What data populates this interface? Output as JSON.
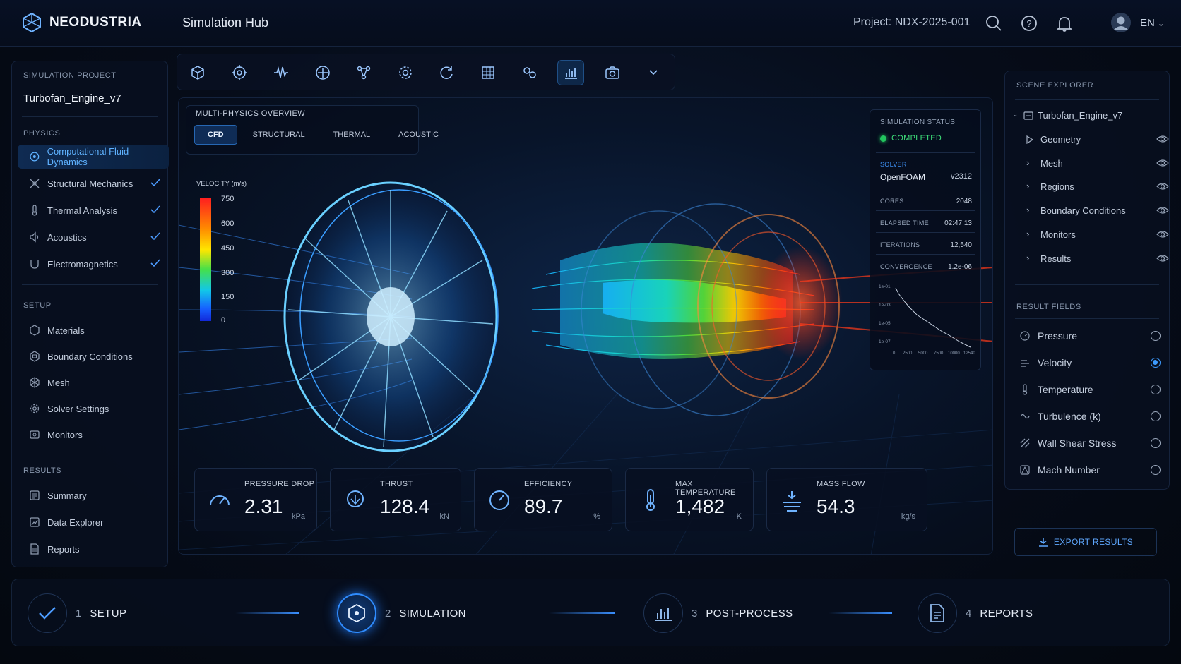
{
  "header": {
    "brand": "NEODUSTRIA",
    "hub": "Simulation Hub",
    "project": "Project: NDX-2025-001",
    "lang": "EN"
  },
  "sidebar": {
    "project_label": "SIMULATION PROJECT",
    "project_name": "Turbofan_Engine_v7",
    "physics_label": "PHYSICS",
    "physics": [
      "Computational Fluid Dynamics",
      "Structural Mechanics",
      "Thermal Analysis",
      "Acoustics",
      "Electromagnetics"
    ],
    "setup_label": "SETUP",
    "setup": [
      "Materials",
      "Boundary Conditions",
      "Mesh",
      "Solver Settings",
      "Monitors"
    ],
    "results_label": "RESULTS",
    "results": [
      "Summary",
      "Data Explorer",
      "Reports"
    ]
  },
  "viewport": {
    "title": "MULTI-PHYSICS OVERVIEW",
    "tabs": [
      "CFD",
      "STRUCTURAL",
      "THERMAL",
      "ACOUSTIC"
    ],
    "legend": {
      "title": "VELOCITY (m/s)",
      "ticks": [
        "750",
        "600",
        "450",
        "300",
        "150",
        "0"
      ]
    },
    "status": {
      "title": "SIMULATION STATUS",
      "state": "COMPLETED",
      "solver_label": "SOLVER",
      "solver": "OpenFOAM",
      "version": "v2312",
      "rows": [
        {
          "k": "CORES",
          "v": "2048"
        },
        {
          "k": "ELAPSED TIME",
          "v": "02:47:13"
        },
        {
          "k": "ITERATIONS",
          "v": "12,540"
        },
        {
          "k": "CONVERGENCE",
          "v": "1.2e-06"
        }
      ],
      "y_ticks": [
        "1e-01",
        "1e-03",
        "1e-05",
        "1e-07"
      ],
      "x_ticks": [
        "0",
        "2500",
        "5000",
        "7500",
        "10000",
        "12540"
      ]
    },
    "metrics": [
      {
        "label": "PRESSURE DROP",
        "value": "2.31",
        "unit": "kPa"
      },
      {
        "label": "THRUST",
        "value": "128.4",
        "unit": "kN"
      },
      {
        "label": "EFFICIENCY",
        "value": "89.7",
        "unit": "%"
      },
      {
        "label": "MAX TEMPERATURE",
        "value": "1,482",
        "unit": "K"
      },
      {
        "label": "MASS FLOW",
        "value": "54.3",
        "unit": "kg/s"
      }
    ]
  },
  "scene": {
    "title": "SCENE EXPLORER",
    "root": "Turbofan_Engine_v7",
    "items": [
      "Geometry",
      "Mesh",
      "Regions",
      "Boundary Conditions",
      "Monitors",
      "Results"
    ]
  },
  "result_fields": {
    "title": "RESULT FIELDS",
    "items": [
      "Pressure",
      "Velocity",
      "Temperature",
      "Turbulence (k)",
      "Wall Shear Stress",
      "Mach Number"
    ],
    "selected": "Velocity"
  },
  "export": "EXPORT RESULTS",
  "steps": [
    {
      "num": "1",
      "label": "SETUP"
    },
    {
      "num": "2",
      "label": "SIMULATION"
    },
    {
      "num": "3",
      "label": "POST-PROCESS"
    },
    {
      "num": "4",
      "label": "REPORTS"
    }
  ],
  "colors": {
    "accent": "#2f8cff",
    "success": "#22c55e",
    "bg": "#060c19"
  }
}
